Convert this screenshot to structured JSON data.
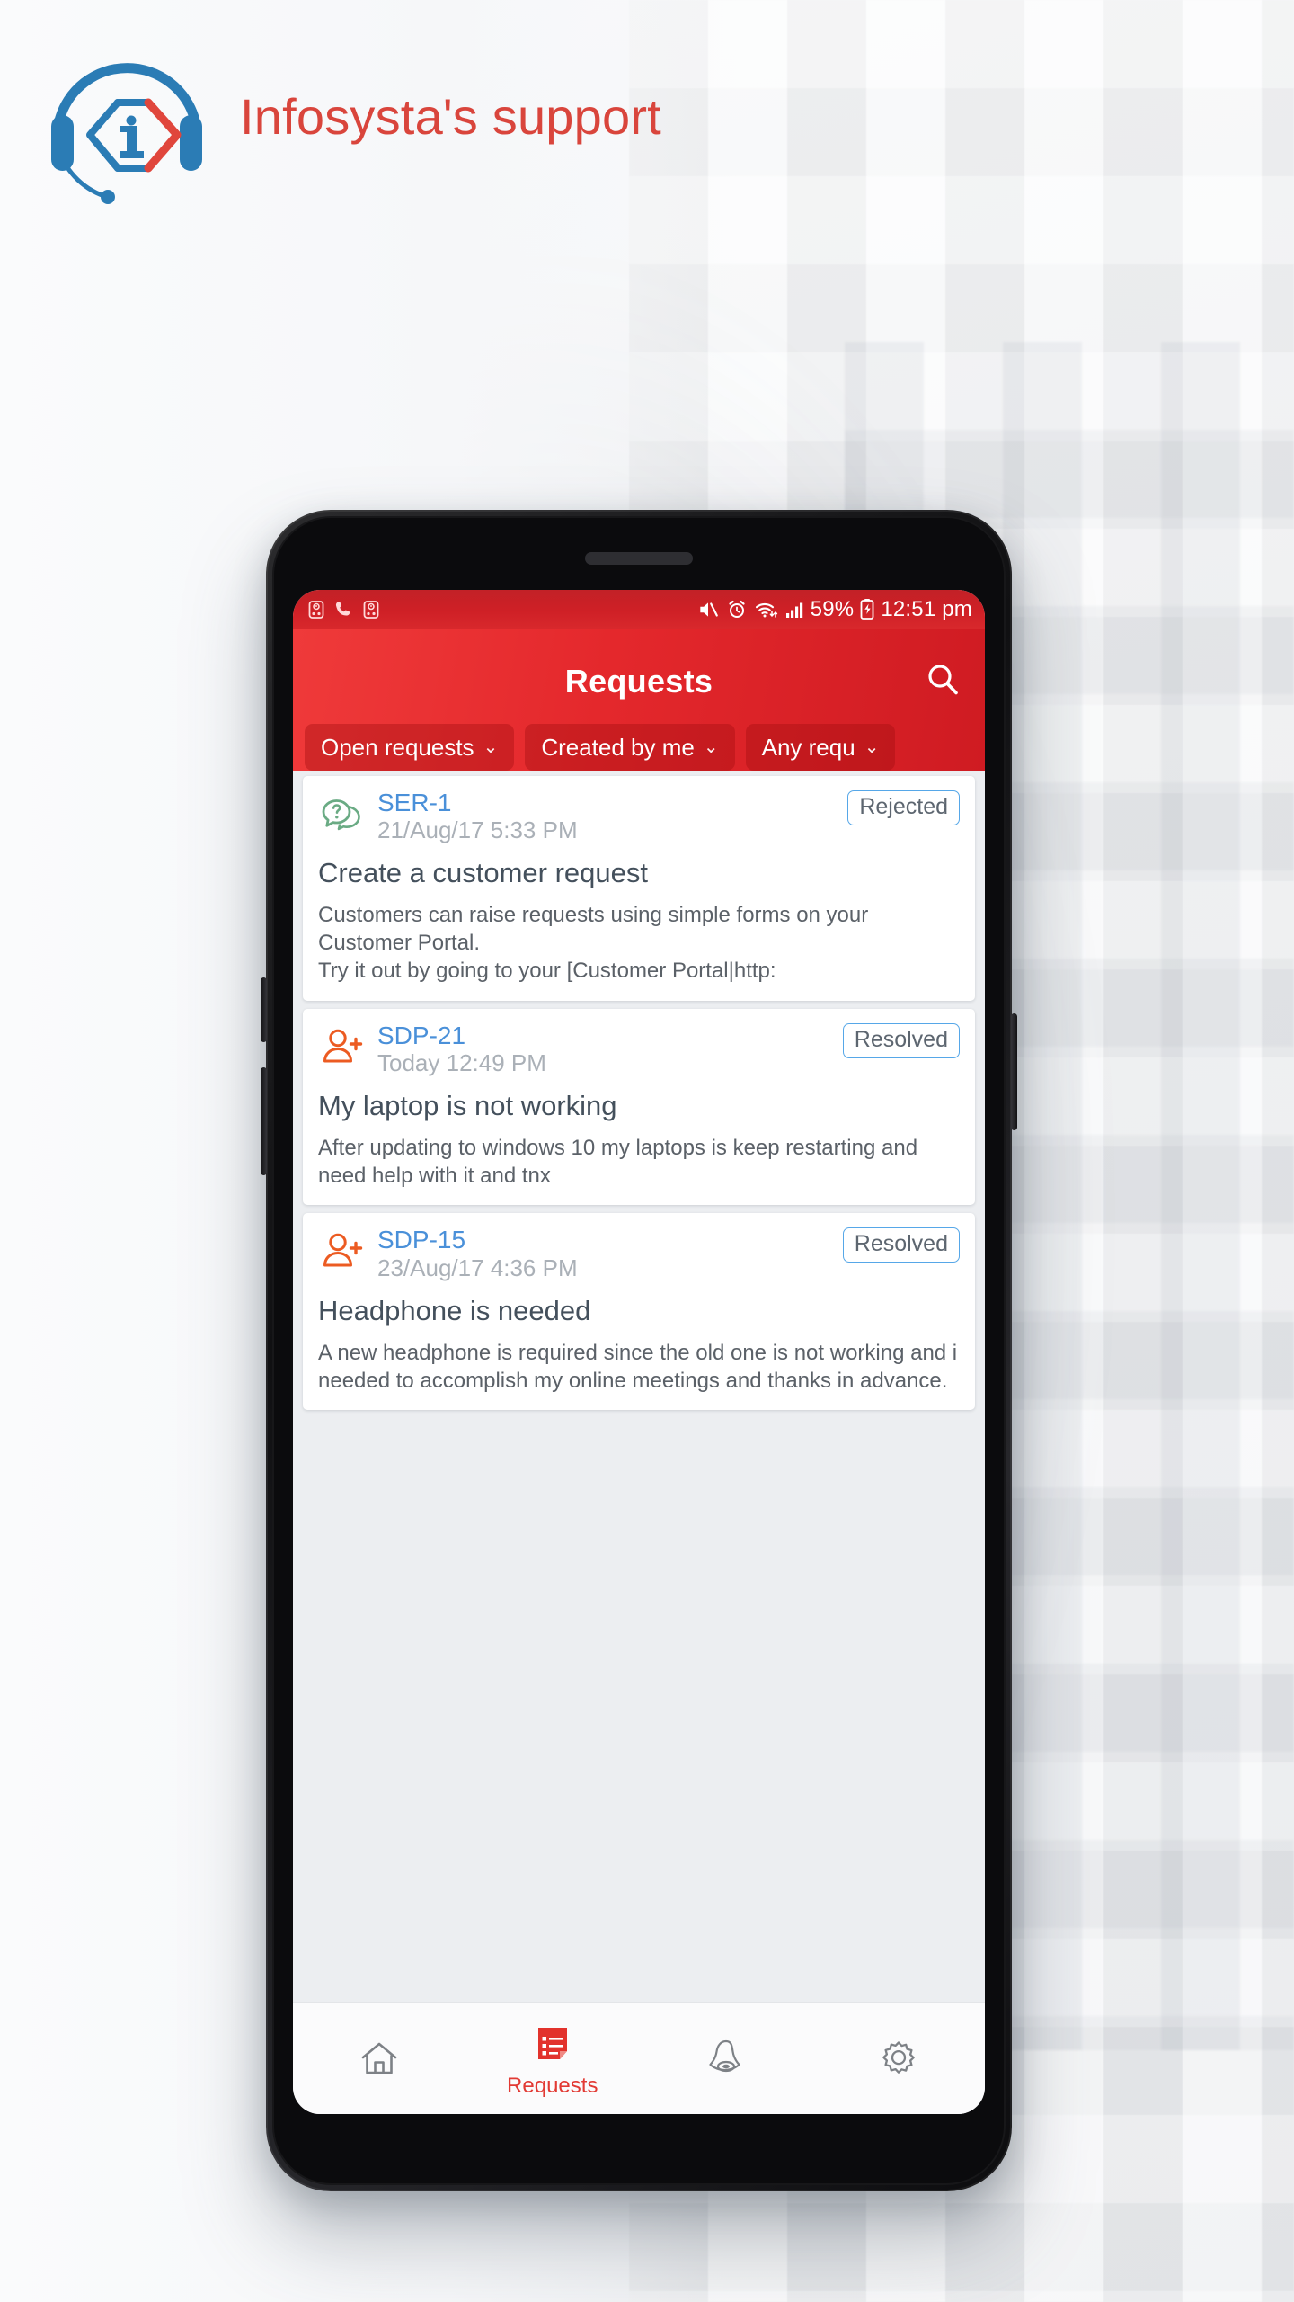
{
  "brand": {
    "title": "Infosysta's support",
    "logo_icon": "headset-info-logo",
    "title_color": "#d9453c",
    "logo_blue": "#2b7cb5",
    "logo_red": "#e0463c"
  },
  "phone": {
    "status_bar": {
      "icons_left": [
        "alarm-clock-icon",
        "phone-call-icon",
        "alarm-clock-icon"
      ],
      "icons_right": [
        "mute-icon",
        "alarm-icon",
        "wifi-icon",
        "signal-bars-icon",
        "battery-charging-icon"
      ],
      "battery_percent": "59%",
      "time": "12:51 pm",
      "background_color": "#cf2026"
    },
    "app_bar": {
      "title": "Requests",
      "search_icon": "search-icon",
      "background_color": "#e4282c",
      "filters": [
        {
          "label": "Open requests",
          "chevron": "chevron-down-icon"
        },
        {
          "label": "Created by me",
          "chevron": "chevron-down-icon"
        },
        {
          "label": "Any requ",
          "chevron": "chevron-down-icon"
        }
      ]
    },
    "requests": [
      {
        "icon": "chat-question-icon",
        "icon_color": "#6aab84",
        "key": "SER-1",
        "date": "21/Aug/17 5:33 PM",
        "status": "Rejected",
        "title": "Create a customer request",
        "body": "Customers can raise requests using simple forms on your Customer Portal.\nTry it out by going to your [Customer Portal|http:"
      },
      {
        "icon": "person-add-icon",
        "icon_color": "#ec5b22",
        "key": "SDP-21",
        "date": "Today 12:49 PM",
        "status": "Resolved",
        "title": "My laptop is not working",
        "body": "After updating to windows 10 my laptops is keep restarting and need help with it and tnx"
      },
      {
        "icon": "person-add-icon",
        "icon_color": "#ec5b22",
        "key": "SDP-15",
        "date": "23/Aug/17 4:36 PM",
        "status": "Resolved",
        "title": "Headphone is needed",
        "body": "A new headphone is required since the old one is not working and i needed to accomplish my online meetings and thanks in advance."
      }
    ],
    "bottom_nav": {
      "active_color": "#e23a34",
      "inactive_color": "#7d8186",
      "items": [
        {
          "icon": "home-icon",
          "label": "",
          "active": false
        },
        {
          "icon": "requests-list-icon",
          "label": "Requests",
          "active": true
        },
        {
          "icon": "notification-bell-icon",
          "label": "",
          "active": false
        },
        {
          "icon": "settings-gear-icon",
          "label": "",
          "active": false
        }
      ]
    }
  }
}
